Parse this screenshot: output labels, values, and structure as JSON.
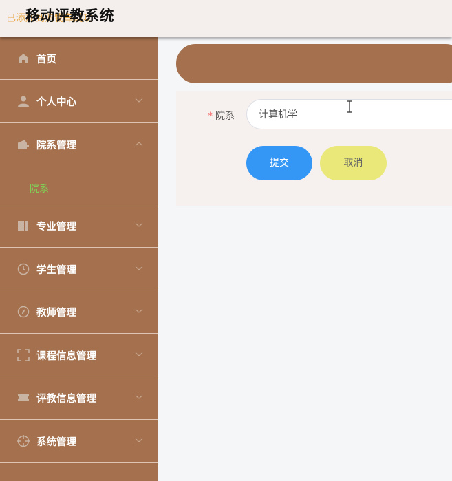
{
  "header": {
    "overlay_text": "已添加到购物车成功",
    "title": "移动评教系统"
  },
  "sidebar": {
    "items": [
      {
        "label": "首页",
        "icon": "home-icon",
        "chevron": "none"
      },
      {
        "label": "个人中心",
        "icon": "user-icon",
        "chevron": "down"
      },
      {
        "label": "院系管理",
        "icon": "wallet-icon",
        "chevron": "up",
        "sub": [
          "院系"
        ]
      },
      {
        "label": "专业管理",
        "icon": "books-icon",
        "chevron": "down"
      },
      {
        "label": "学生管理",
        "icon": "clock-icon",
        "chevron": "down"
      },
      {
        "label": "教师管理",
        "icon": "compass-icon",
        "chevron": "down"
      },
      {
        "label": "课程信息管理",
        "icon": "fullscreen-icon",
        "chevron": "down"
      },
      {
        "label": "评教信息管理",
        "icon": "ticket-icon",
        "chevron": "down"
      },
      {
        "label": "系统管理",
        "icon": "crosshair-icon",
        "chevron": "down"
      }
    ],
    "active_sub": "院系"
  },
  "form": {
    "field_label": "院系",
    "required_mark": "*",
    "field_value": "计算机学",
    "submit_label": "提交",
    "cancel_label": "取消"
  },
  "colors": {
    "sidebar_bg": "#a4704d",
    "submenu_active": "#7fd657",
    "submit": "#3497f5",
    "cancel": "#e9e879"
  }
}
